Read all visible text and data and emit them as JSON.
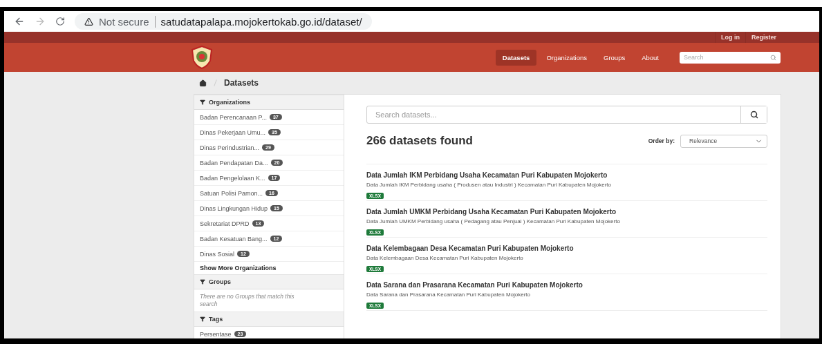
{
  "browser": {
    "security": "Not secure",
    "url": "satudatapalapa.mojokertokab.go.id/dataset/"
  },
  "account": [
    "Log in",
    "Register"
  ],
  "nav": [
    {
      "label": "Datasets",
      "selected": true
    },
    {
      "label": "Organizations",
      "selected": false
    },
    {
      "label": "Groups",
      "selected": false
    },
    {
      "label": "About",
      "selected": false
    }
  ],
  "site_search": {
    "placeholder": "Search"
  },
  "breadcrumb": "Datasets",
  "facets": [
    {
      "title": "Organizations",
      "items": [
        {
          "label": "Badan Perencanaan P...",
          "count": "37"
        },
        {
          "label": "Dinas Pekerjaan Umu...",
          "count": "35"
        },
        {
          "label": "Dinas Perindustrian...",
          "count": "29"
        },
        {
          "label": "Badan Pendapatan Da...",
          "count": "20"
        },
        {
          "label": "Badan Pengelolaan K...",
          "count": "17"
        },
        {
          "label": "Satuan Polisi Pamon...",
          "count": "16"
        },
        {
          "label": "Dinas Lingkungan Hidup",
          "count": "15"
        },
        {
          "label": "Sekretariat DPRD",
          "count": "13"
        },
        {
          "label": "Badan Kesatuan Bang...",
          "count": "12"
        },
        {
          "label": "Dinas Sosial",
          "count": "12"
        }
      ],
      "more": "Show More Organizations"
    },
    {
      "title": "Groups",
      "empty": "There are no Groups that match this search"
    },
    {
      "title": "Tags",
      "items": [
        {
          "label": "Persentase",
          "count": "23"
        }
      ]
    }
  ],
  "dataset_search": {
    "placeholder": "Search datasets..."
  },
  "results_count": "266 datasets found",
  "order": {
    "label": "Order by:",
    "value": "Relevance"
  },
  "datasets": [
    {
      "title": "Data Jumlah IKM Perbidang Usaha Kecamatan Puri Kabupaten Mojokerto",
      "notes": "Data Jumlah IKM Perbidang usaha ( Produsen atau Industri ) Kecamatan Puri Kabupaten Mojokerto",
      "format": "XLSX"
    },
    {
      "title": "Data Jumlah UMKM Perbidang Usaha Kecamatan Puri Kabupaten Mojokerto",
      "notes": "Data Jumlah UMKM Perbidang usaha ( Pedagang atau Penjual ) Kecamatan Puri Kabupaten Mojokerto",
      "format": "XLSX"
    },
    {
      "title": "Data Kelembagaan Desa Kecamatan Puri Kabupaten Mojokerto",
      "notes": "Data Kelembagaan Desa Kecamatan Puri Kabupaten Mojokerto",
      "format": "XLSX"
    },
    {
      "title": "Data Sarana dan Prasarana Kecamatan Puri Kabupaten Mojokerto",
      "notes": "Data Sarana dan Prasarana Kecamatan Puri Kabupaten Mojokerto",
      "format": "XLSX"
    }
  ]
}
